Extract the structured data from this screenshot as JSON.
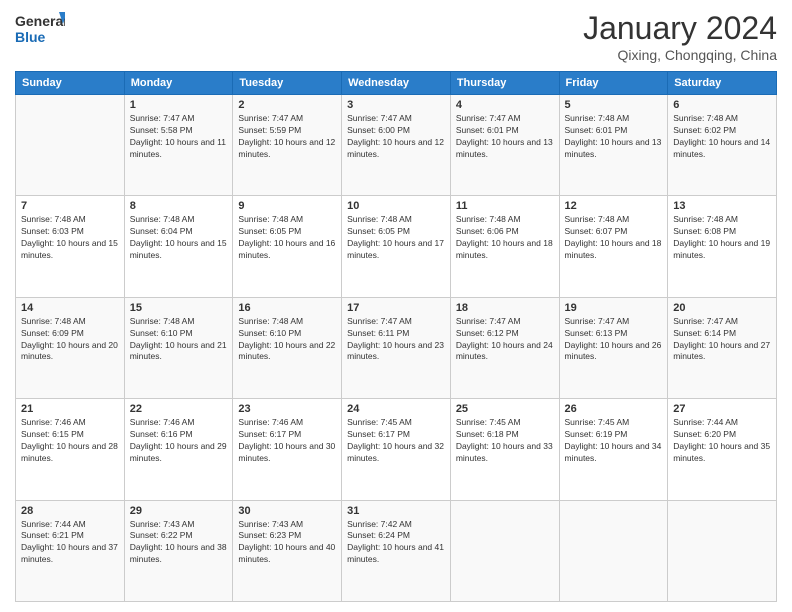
{
  "header": {
    "logo_general": "General",
    "logo_blue": "Blue",
    "month_year": "January 2024",
    "location": "Qixing, Chongqing, China"
  },
  "days_of_week": [
    "Sunday",
    "Monday",
    "Tuesday",
    "Wednesday",
    "Thursday",
    "Friday",
    "Saturday"
  ],
  "weeks": [
    [
      {
        "day": "",
        "info": ""
      },
      {
        "day": "1",
        "info": "Sunrise: 7:47 AM\nSunset: 5:58 PM\nDaylight: 10 hours and 11 minutes."
      },
      {
        "day": "2",
        "info": "Sunrise: 7:47 AM\nSunset: 5:59 PM\nDaylight: 10 hours and 12 minutes."
      },
      {
        "day": "3",
        "info": "Sunrise: 7:47 AM\nSunset: 6:00 PM\nDaylight: 10 hours and 12 minutes."
      },
      {
        "day": "4",
        "info": "Sunrise: 7:47 AM\nSunset: 6:01 PM\nDaylight: 10 hours and 13 minutes."
      },
      {
        "day": "5",
        "info": "Sunrise: 7:48 AM\nSunset: 6:01 PM\nDaylight: 10 hours and 13 minutes."
      },
      {
        "day": "6",
        "info": "Sunrise: 7:48 AM\nSunset: 6:02 PM\nDaylight: 10 hours and 14 minutes."
      }
    ],
    [
      {
        "day": "7",
        "info": "Sunrise: 7:48 AM\nSunset: 6:03 PM\nDaylight: 10 hours and 15 minutes."
      },
      {
        "day": "8",
        "info": "Sunrise: 7:48 AM\nSunset: 6:04 PM\nDaylight: 10 hours and 15 minutes."
      },
      {
        "day": "9",
        "info": "Sunrise: 7:48 AM\nSunset: 6:05 PM\nDaylight: 10 hours and 16 minutes."
      },
      {
        "day": "10",
        "info": "Sunrise: 7:48 AM\nSunset: 6:05 PM\nDaylight: 10 hours and 17 minutes."
      },
      {
        "day": "11",
        "info": "Sunrise: 7:48 AM\nSunset: 6:06 PM\nDaylight: 10 hours and 18 minutes."
      },
      {
        "day": "12",
        "info": "Sunrise: 7:48 AM\nSunset: 6:07 PM\nDaylight: 10 hours and 18 minutes."
      },
      {
        "day": "13",
        "info": "Sunrise: 7:48 AM\nSunset: 6:08 PM\nDaylight: 10 hours and 19 minutes."
      }
    ],
    [
      {
        "day": "14",
        "info": "Sunrise: 7:48 AM\nSunset: 6:09 PM\nDaylight: 10 hours and 20 minutes."
      },
      {
        "day": "15",
        "info": "Sunrise: 7:48 AM\nSunset: 6:10 PM\nDaylight: 10 hours and 21 minutes."
      },
      {
        "day": "16",
        "info": "Sunrise: 7:48 AM\nSunset: 6:10 PM\nDaylight: 10 hours and 22 minutes."
      },
      {
        "day": "17",
        "info": "Sunrise: 7:47 AM\nSunset: 6:11 PM\nDaylight: 10 hours and 23 minutes."
      },
      {
        "day": "18",
        "info": "Sunrise: 7:47 AM\nSunset: 6:12 PM\nDaylight: 10 hours and 24 minutes."
      },
      {
        "day": "19",
        "info": "Sunrise: 7:47 AM\nSunset: 6:13 PM\nDaylight: 10 hours and 26 minutes."
      },
      {
        "day": "20",
        "info": "Sunrise: 7:47 AM\nSunset: 6:14 PM\nDaylight: 10 hours and 27 minutes."
      }
    ],
    [
      {
        "day": "21",
        "info": "Sunrise: 7:46 AM\nSunset: 6:15 PM\nDaylight: 10 hours and 28 minutes."
      },
      {
        "day": "22",
        "info": "Sunrise: 7:46 AM\nSunset: 6:16 PM\nDaylight: 10 hours and 29 minutes."
      },
      {
        "day": "23",
        "info": "Sunrise: 7:46 AM\nSunset: 6:17 PM\nDaylight: 10 hours and 30 minutes."
      },
      {
        "day": "24",
        "info": "Sunrise: 7:45 AM\nSunset: 6:17 PM\nDaylight: 10 hours and 32 minutes."
      },
      {
        "day": "25",
        "info": "Sunrise: 7:45 AM\nSunset: 6:18 PM\nDaylight: 10 hours and 33 minutes."
      },
      {
        "day": "26",
        "info": "Sunrise: 7:45 AM\nSunset: 6:19 PM\nDaylight: 10 hours and 34 minutes."
      },
      {
        "day": "27",
        "info": "Sunrise: 7:44 AM\nSunset: 6:20 PM\nDaylight: 10 hours and 35 minutes."
      }
    ],
    [
      {
        "day": "28",
        "info": "Sunrise: 7:44 AM\nSunset: 6:21 PM\nDaylight: 10 hours and 37 minutes."
      },
      {
        "day": "29",
        "info": "Sunrise: 7:43 AM\nSunset: 6:22 PM\nDaylight: 10 hours and 38 minutes."
      },
      {
        "day": "30",
        "info": "Sunrise: 7:43 AM\nSunset: 6:23 PM\nDaylight: 10 hours and 40 minutes."
      },
      {
        "day": "31",
        "info": "Sunrise: 7:42 AM\nSunset: 6:24 PM\nDaylight: 10 hours and 41 minutes."
      },
      {
        "day": "",
        "info": ""
      },
      {
        "day": "",
        "info": ""
      },
      {
        "day": "",
        "info": ""
      }
    ]
  ]
}
